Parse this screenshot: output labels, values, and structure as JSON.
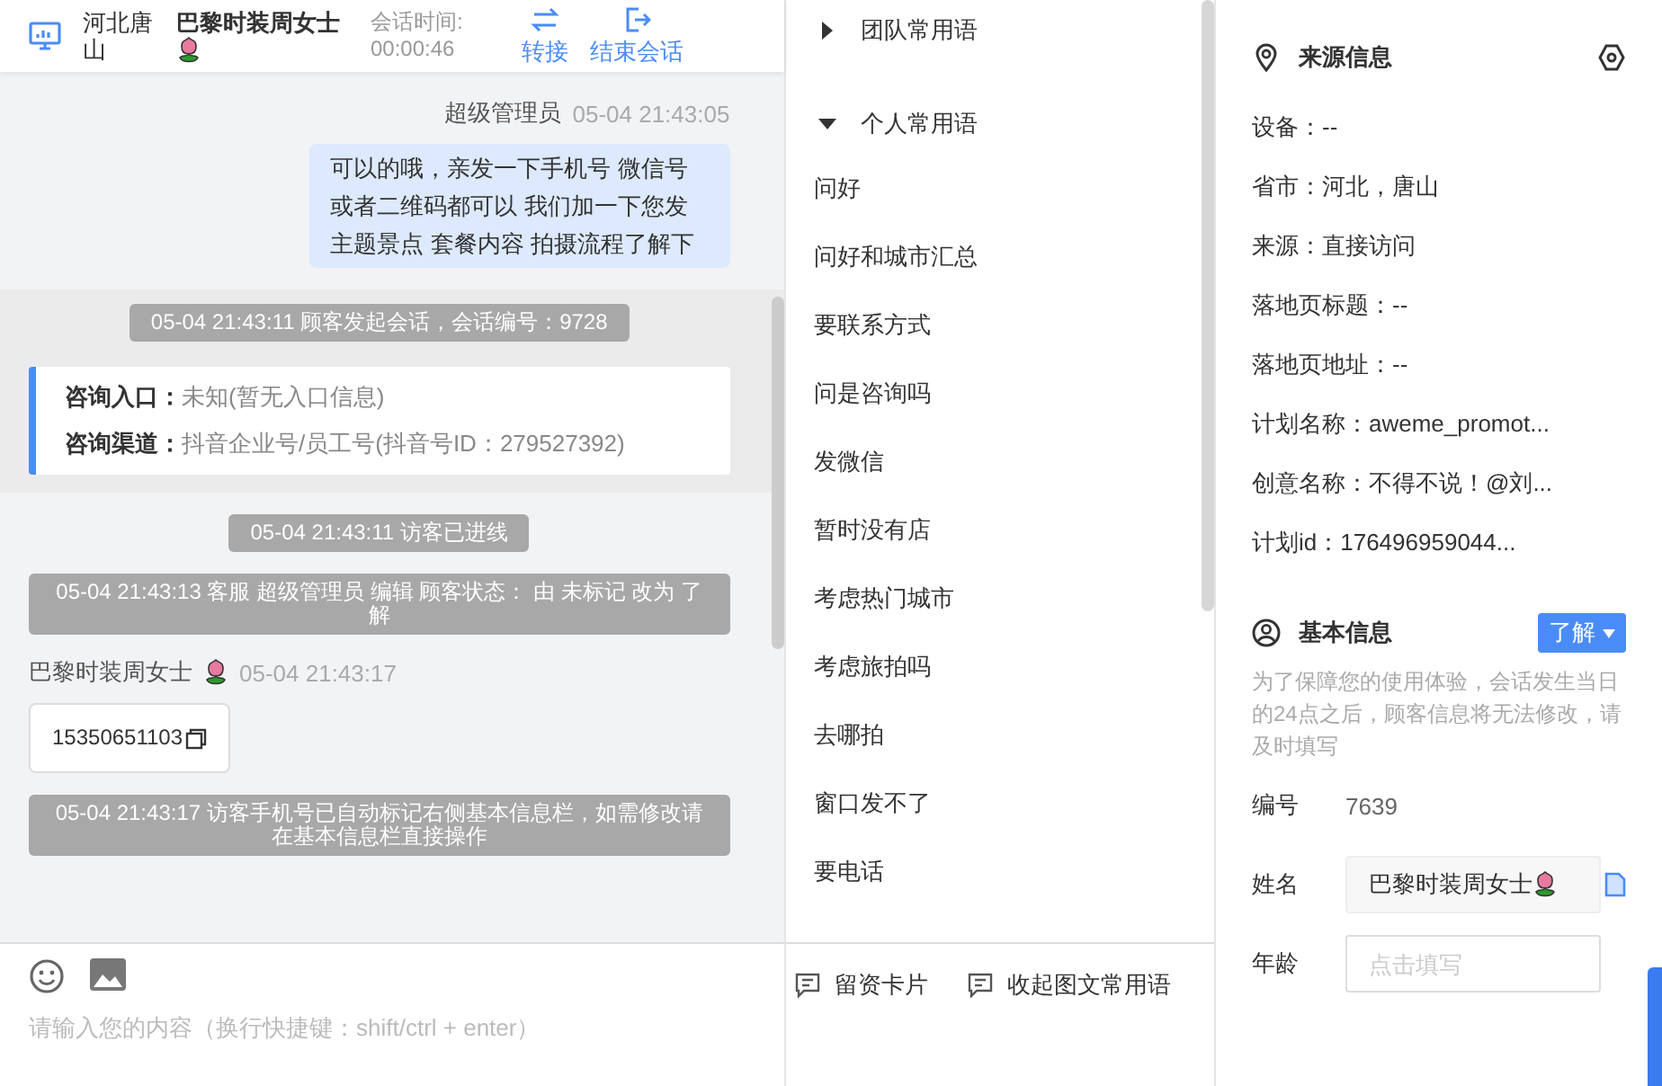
{
  "header": {
    "location": "河北唐山",
    "visitor_name": "巴黎时装周女士",
    "session_time_label": "会话时间:",
    "session_time": "00:00:46",
    "actions": [
      {
        "label": "转接",
        "kind": "transfer"
      },
      {
        "label": "结束会话",
        "kind": "end"
      }
    ]
  },
  "messages": [
    {
      "kind": "agent",
      "sender": "超级管理员",
      "time": "05-04 21:43:05",
      "text": "可以的哦，亲发一下手机号 微信号或者二维码都可以 我们加一下您发主题景点 套餐内容 拍摄流程了解下"
    },
    {
      "kind": "session",
      "notice": "05-04 21:43:11 顾客发起会话，会话编号：9728",
      "rows": [
        {
          "label": "咨询入口：",
          "value": "未知(暂无入口信息)"
        },
        {
          "label": "咨询渠道：",
          "value": "抖音企业号/员工号(抖音号ID：279527392)"
        }
      ]
    },
    {
      "kind": "notice",
      "text": "05-04 21:43:11 访客已进线"
    },
    {
      "kind": "notice",
      "text": "05-04 21:43:13 客服 超级管理员 编辑 顾客状态： 由 未标记 改为 了解"
    },
    {
      "kind": "visitor",
      "sender": "巴黎时装周女士",
      "time": "05-04 21:43:17",
      "text": "15350651103"
    },
    {
      "kind": "notice",
      "text": "05-04 21:43:17 访客手机号已自动标记右侧基本信息栏，如需修改请在基本信息栏直接操作"
    }
  ],
  "input": {
    "placeholder": "请输入您的内容（换行快捷键：shift/ctrl + enter）"
  },
  "phrases": {
    "groups": [
      {
        "label": "团队常用语",
        "expanded": false
      },
      {
        "label": "个人常用语",
        "expanded": true,
        "children": [
          "问好",
          "问好和城市汇总",
          "要联系方式",
          "问是咨询吗",
          "发微信",
          "暂时没有店",
          "考虑热门城市",
          "考虑旅拍吗",
          "去哪拍",
          "窗口发不了",
          "要电话"
        ]
      }
    ],
    "actions": [
      "留资卡片",
      "收起图文常用语"
    ]
  },
  "source_info": {
    "title": "来源信息",
    "fields": [
      "设备：--",
      "省市：河北，唐山",
      "来源：直接访问",
      "落地页标题：--",
      "落地页地址：--",
      "计划名称：aweme_promot...",
      "创意名称：不得不说！@刘...",
      "计划id：176496959044..."
    ]
  },
  "basic_info": {
    "title": "基本信息",
    "status": "了解",
    "note": "为了保障您的使用体验，会话发生当日的24点之后，顾客信息将无法修改，请及时填写",
    "fields": [
      {
        "kind": "text",
        "label": "编号",
        "value": "7639"
      },
      {
        "kind": "filled",
        "label": "姓名",
        "value": "巴黎时装周女士"
      },
      {
        "kind": "input",
        "label": "年龄",
        "placeholder": "点击填写"
      }
    ]
  }
}
